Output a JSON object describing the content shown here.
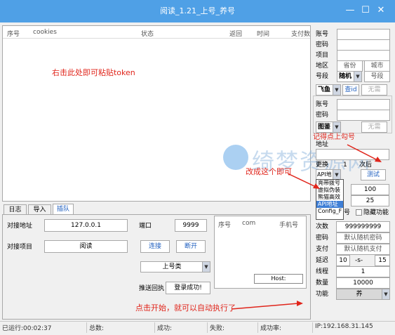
{
  "window": {
    "title": "阅读_1.21_上号_养号",
    "min": "—",
    "max": "☐",
    "close": "✕"
  },
  "main_table": {
    "columns": [
      "序号",
      "cookies",
      "状态",
      "返回",
      "时间",
      "支付数"
    ],
    "paste_hint": "右击此处即可粘贴token"
  },
  "right_panel1": {
    "account_label": "账号",
    "password_label": "密码",
    "item_label": "项目",
    "region_label": "地区",
    "province_placeholder": "省份",
    "city_placeholder": "城市",
    "number_label": "号段",
    "number_select": "随机",
    "number_placeholder": "号段",
    "platform_select": "飞鱼",
    "query_id_button": "查id",
    "no_button": "无需"
  },
  "right_panel2": {
    "account_label": "账号",
    "password_label": "密码",
    "captcha_select": "图鉴",
    "no_button": "无需"
  },
  "right_panel3": {
    "address_label": "地址",
    "replace_label": "更换",
    "count_value": "1",
    "times_label": "次后",
    "api_select": "API地",
    "test_button": "测试",
    "dropdown_options": [
      "亮带拨号",
      "虚拟伪装",
      "熊猫高效",
      "API地址",
      "Config_F"
    ],
    "dropdown_selected_index": 3,
    "value1": "100",
    "value2": "25",
    "hidden_label": "隐藏功能",
    "trunc_label": "号"
  },
  "right_panel4": {
    "times_label": "次数",
    "times_value": "999999999",
    "password_label": "密码",
    "password_value": "默认随机密码",
    "pay_label": "支付",
    "pay_value": "默认随机支付",
    "delay_label": "延迟",
    "delay_from": "10",
    "delay_sep": "-s-",
    "delay_to": "15",
    "threads_label": "线程",
    "threads_value": "1",
    "quantity_label": "数量",
    "quantity_value": "10000",
    "function_label": "功能",
    "function_value": "养"
  },
  "tabs": [
    "日志",
    "导入",
    "插队"
  ],
  "connect": {
    "address_label": "对接地址",
    "address_value": "127.0.0.1",
    "port_label": "端口",
    "port_value": "9999",
    "project_label": "对接项目",
    "project_value": "阅读",
    "connect_button": "连接",
    "disconnect_button": "断开",
    "mode_select": "上号类",
    "feedback_label": "推送回执",
    "feedback_value": "登录成功!"
  },
  "small_table": {
    "columns": [
      "序号",
      "com",
      "手机号"
    ],
    "host_text": "Host:"
  },
  "annotations": {
    "remember_check": "记得点上勾号",
    "change_this": "改成这个即可",
    "click_start": "点击开始，就可以自动执行了"
  },
  "watermark": {
    "text": "绮梦资源网"
  },
  "statusbar": {
    "runtime": "已运行:00:02:37",
    "total": "总数:",
    "success": "成功:",
    "fail": "失败:",
    "rate": "成功率:",
    "ip": "IP:192.168.31.145"
  },
  "colors": {
    "titlebar": "#4fa0e6",
    "annotation": "#e0251b",
    "selected": "#3f7fd6"
  }
}
